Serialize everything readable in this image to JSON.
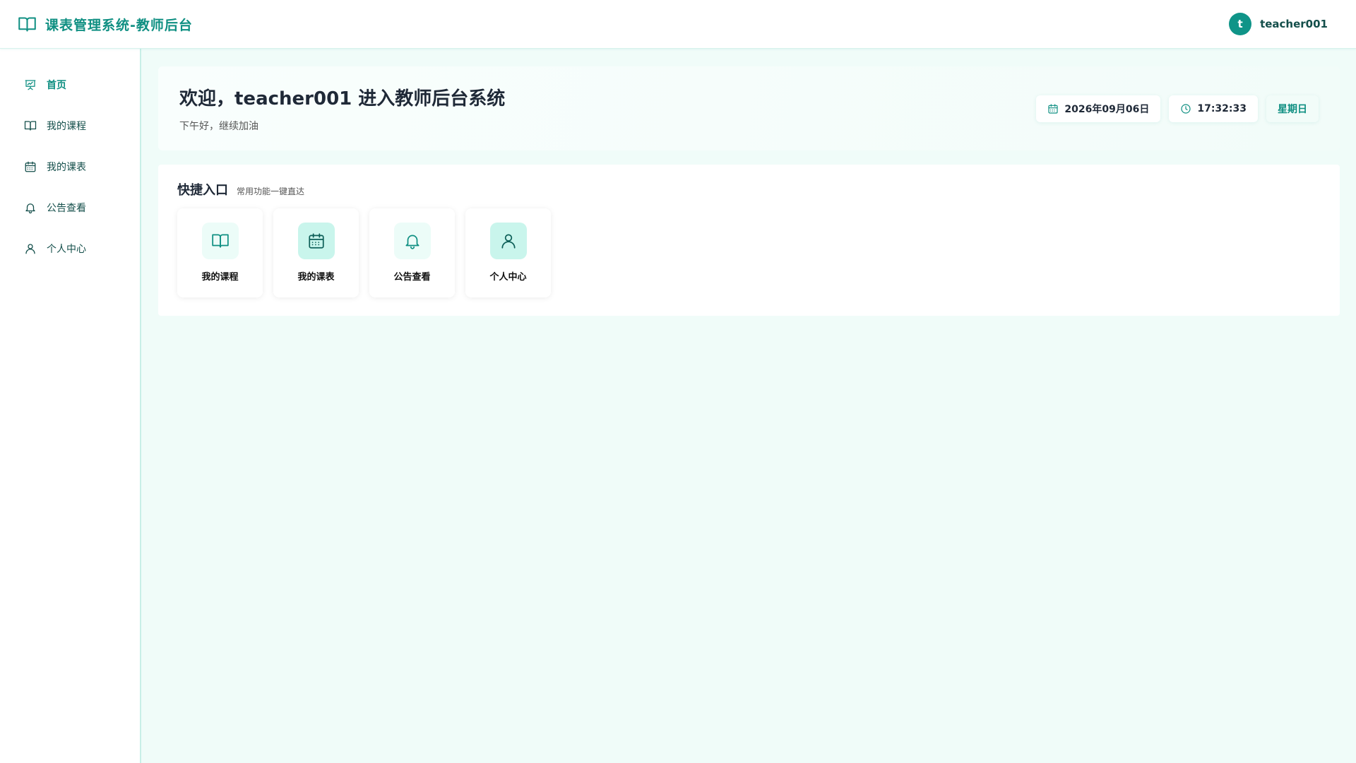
{
  "header": {
    "title": "课表管理系统-教师后台",
    "brand_icon": "book-open-icon",
    "user": {
      "avatar_letter": "t",
      "name": "teacher001"
    }
  },
  "sidebar": {
    "items": [
      {
        "label": "首页",
        "icon": "presentation-chart-icon",
        "active": true
      },
      {
        "label": "我的课程",
        "icon": "book-open-icon",
        "active": false
      },
      {
        "label": "我的课表",
        "icon": "calendar-icon",
        "active": false
      },
      {
        "label": "公告查看",
        "icon": "bell-icon",
        "active": false
      },
      {
        "label": "个人中心",
        "icon": "user-icon",
        "active": false
      }
    ]
  },
  "welcome": {
    "title": "欢迎，teacher001 进入教师后台系统",
    "subtitle": "下午好，继续加油",
    "date": "2026年09月06日",
    "time": "17:32:33",
    "weekday": "星期日"
  },
  "quick": {
    "title": "快捷入口",
    "desc": "常用功能一键直达",
    "cards": [
      {
        "label": "我的课程",
        "icon": "book-open-icon"
      },
      {
        "label": "我的课表",
        "icon": "calendar-icon"
      },
      {
        "label": "公告查看",
        "icon": "bell-icon"
      },
      {
        "label": "个人中心",
        "icon": "user-icon"
      }
    ]
  },
  "colors": {
    "accent": "#0f9488",
    "accent_text": "#0f8f82",
    "page_bg": "#f0fcf9"
  }
}
